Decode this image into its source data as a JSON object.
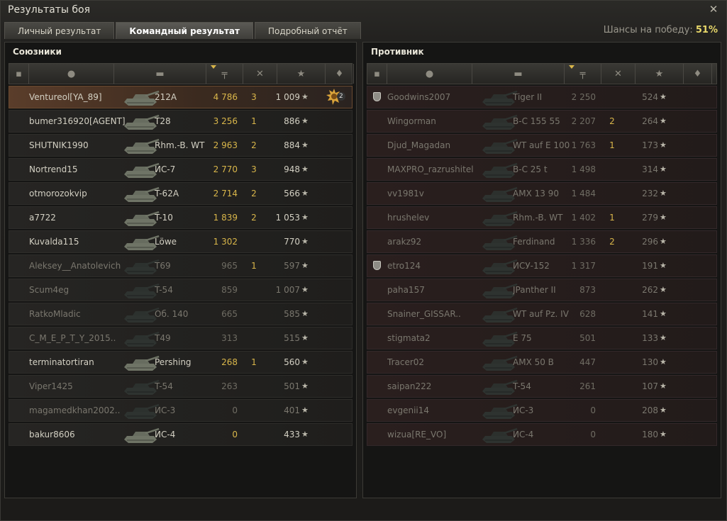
{
  "window": {
    "title": "Результаты боя",
    "close_icon": "close-icon"
  },
  "tabs": [
    {
      "label": "Личный результат",
      "active": false
    },
    {
      "label": "Командный результат",
      "active": true
    },
    {
      "label": "Подробный отчёт",
      "active": false
    }
  ],
  "chance": {
    "label": "Шансы на победу:",
    "value": "51%"
  },
  "columns": [
    "platoon-icon",
    "player-icon",
    "tank-icon",
    "damage-icon",
    "kills-icon",
    "xp-star-icon",
    "medal-icon"
  ],
  "allies": {
    "title": "Союзники",
    "rows": [
      {
        "name": "Ventureol[YA_89]",
        "tank": "212A",
        "damage": "4 786",
        "kills": "3",
        "xp": "1 009",
        "me": true,
        "dead": false,
        "medal": "2"
      },
      {
        "name": "bumer316920[AGENT]",
        "tank": "T28",
        "damage": "3 256",
        "kills": "1",
        "xp": "886",
        "dead": false
      },
      {
        "name": "SHUTNIK1990",
        "tank": "Rhm.-B. WT",
        "damage": "2 963",
        "kills": "2",
        "xp": "884",
        "dead": false
      },
      {
        "name": "Nortrend15",
        "tank": "ИС-7",
        "damage": "2 770",
        "kills": "3",
        "xp": "948",
        "dead": false
      },
      {
        "name": "otmorozokvip",
        "tank": "T-62A",
        "damage": "2 714",
        "kills": "2",
        "xp": "566",
        "dead": false
      },
      {
        "name": "a7722",
        "tank": "T-10",
        "damage": "1 839",
        "kills": "2",
        "xp": "1 053",
        "dead": false
      },
      {
        "name": "Kuvalda115",
        "tank": "Löwe",
        "damage": "1 302",
        "kills": "",
        "xp": "770",
        "dead": false
      },
      {
        "name": "Aleksey__Anatolevich",
        "tank": "T69",
        "damage": "965",
        "kills": "1",
        "xp": "597",
        "dead": true
      },
      {
        "name": "Scum4eg",
        "tank": "T-54",
        "damage": "859",
        "kills": "",
        "xp": "1 007",
        "dead": true
      },
      {
        "name": "RatkoMladic",
        "tank": "Об. 140",
        "damage": "665",
        "kills": "",
        "xp": "585",
        "dead": true
      },
      {
        "name": "C_M_E_P_T_Y_2015..",
        "tank": "T49",
        "damage": "313",
        "kills": "",
        "xp": "515",
        "dead": true
      },
      {
        "name": "terminatortiran",
        "tank": "Pershing",
        "damage": "268",
        "kills": "1",
        "xp": "560",
        "dead": false
      },
      {
        "name": "Viper1425",
        "tank": "T-54",
        "damage": "263",
        "kills": "",
        "xp": "501",
        "dead": true
      },
      {
        "name": "magamedkhan2002..",
        "tank": "ИС-3",
        "damage": "0",
        "kills": "",
        "xp": "401",
        "dead": true
      },
      {
        "name": "bakur8606",
        "tank": "ИС-4",
        "damage": "0",
        "kills": "",
        "xp": "433",
        "dead": false
      }
    ]
  },
  "enemies": {
    "title": "Противник",
    "rows": [
      {
        "name": "Goodwins2007",
        "tank": "Tiger II",
        "damage": "2 250",
        "kills": "",
        "xp": "524",
        "dead": true,
        "premium": true
      },
      {
        "name": "Wingorman",
        "tank": "B-C 155 55",
        "damage": "2 207",
        "kills": "2",
        "xp": "264",
        "dead": true
      },
      {
        "name": "Djud_Magadan",
        "tank": "WT auf E 100",
        "damage": "1 763",
        "kills": "1",
        "xp": "173",
        "dead": true
      },
      {
        "name": "MAXPRO_razrushitel",
        "tank": "B-C 25 t",
        "damage": "1 498",
        "kills": "",
        "xp": "314",
        "dead": true
      },
      {
        "name": "vv1981v",
        "tank": "AMX 13 90",
        "damage": "1 484",
        "kills": "",
        "xp": "232",
        "dead": true
      },
      {
        "name": "hrushelev",
        "tank": "Rhm.-B. WT",
        "damage": "1 402",
        "kills": "1",
        "xp": "279",
        "dead": true
      },
      {
        "name": "arakz92",
        "tank": "Ferdinand",
        "damage": "1 336",
        "kills": "2",
        "xp": "296",
        "dead": true
      },
      {
        "name": "etro124",
        "tank": "ИСУ-152",
        "damage": "1 317",
        "kills": "",
        "xp": "191",
        "dead": true,
        "premium": true
      },
      {
        "name": "paha157",
        "tank": "JPanther II",
        "damage": "873",
        "kills": "",
        "xp": "262",
        "dead": true
      },
      {
        "name": "Snainer_GISSAR..",
        "tank": "WT auf Pz. IV",
        "damage": "628",
        "kills": "",
        "xp": "141",
        "dead": true
      },
      {
        "name": "stigmata2",
        "tank": "E 75",
        "damage": "501",
        "kills": "",
        "xp": "133",
        "dead": true
      },
      {
        "name": "Tracer02",
        "tank": "AMX 50 B",
        "damage": "447",
        "kills": "",
        "xp": "130",
        "dead": true
      },
      {
        "name": "saipan222",
        "tank": "T-54",
        "damage": "261",
        "kills": "",
        "xp": "107",
        "dead": true
      },
      {
        "name": "evgenii14",
        "tank": "ИС-3",
        "damage": "0",
        "kills": "",
        "xp": "208",
        "dead": true
      },
      {
        "name": "wizua[RE_VO]",
        "tank": "ИС-4",
        "damage": "0",
        "kills": "",
        "xp": "180",
        "dead": true
      }
    ]
  }
}
